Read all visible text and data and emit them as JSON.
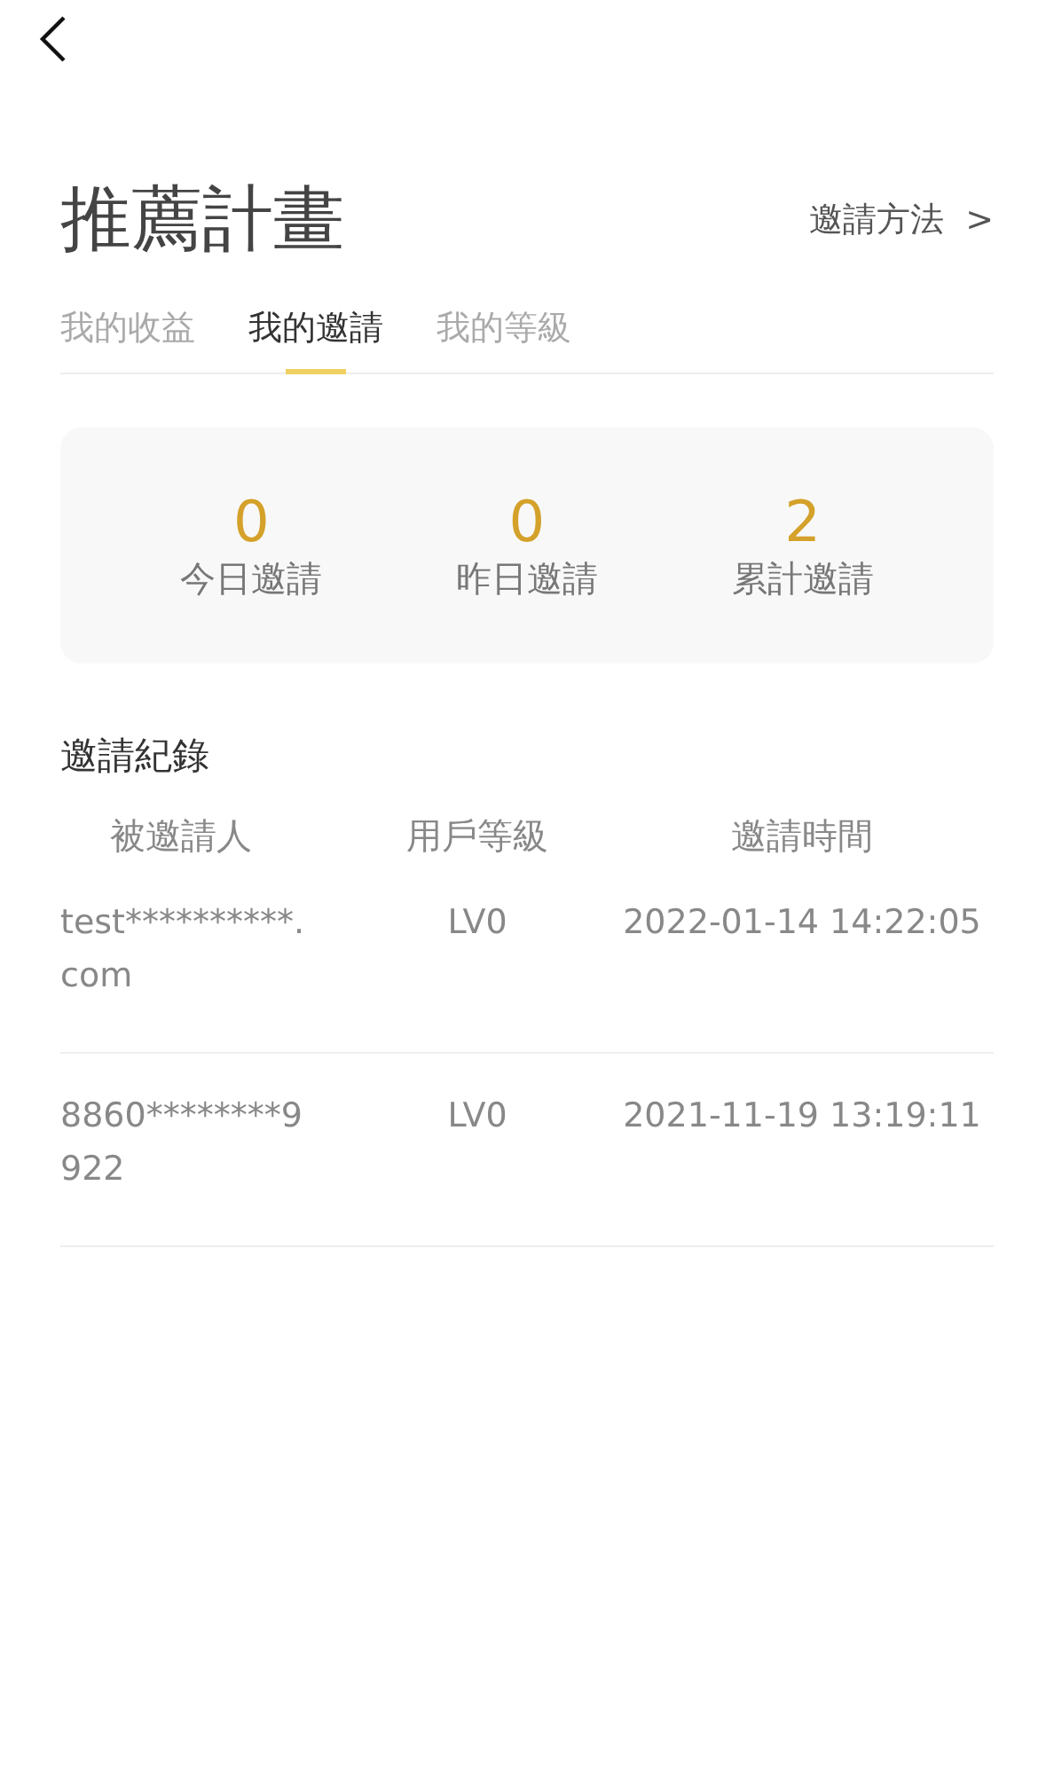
{
  "page": {
    "title": "推薦計畫",
    "invite_method": "邀請方法  >"
  },
  "tabs": [
    {
      "label": "我的收益",
      "selected": false
    },
    {
      "label": "我的邀請",
      "selected": true
    },
    {
      "label": "我的等級",
      "selected": false
    }
  ],
  "stats": [
    {
      "value": "0",
      "label": "今日邀請"
    },
    {
      "value": "0",
      "label": "昨日邀請"
    },
    {
      "value": "2",
      "label": "累計邀請"
    }
  ],
  "records": {
    "title": "邀請紀錄",
    "columns": [
      "被邀請人",
      "用戶等級",
      "邀請時間"
    ],
    "rows": [
      {
        "invitee": "test**********.com",
        "level": "LV0",
        "time": "2022-01-14 14:22:05"
      },
      {
        "invitee": "8860********9922",
        "level": "LV0",
        "time": "2021-11-19 13:19:11"
      }
    ]
  }
}
